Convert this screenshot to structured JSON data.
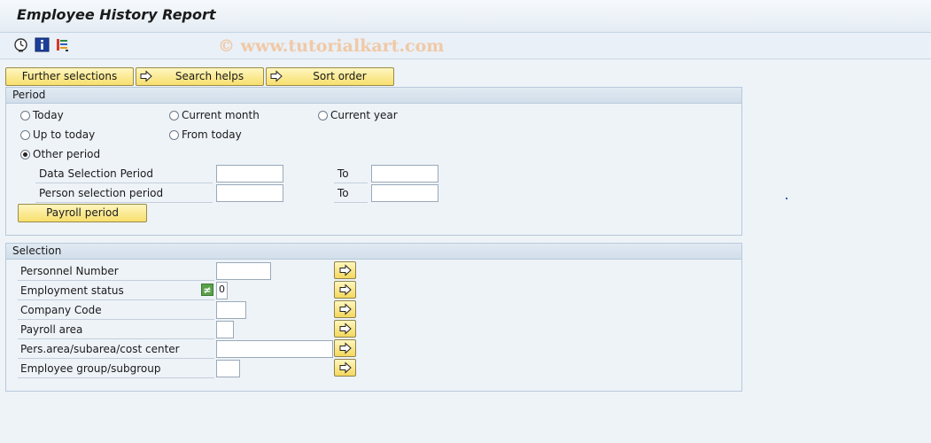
{
  "window": {
    "title": "Employee History Report"
  },
  "toolbar": {
    "icons": [
      "execute-icon",
      "info-icon",
      "variants-icon"
    ],
    "watermark": "© www.tutorialkart.com"
  },
  "buttons": {
    "further_selections": "Further selections",
    "search_helps": "Search helps",
    "sort_order": "Sort order"
  },
  "period": {
    "header": "Period",
    "options": {
      "today": "Today",
      "current_month": "Current month",
      "current_year": "Current year",
      "up_to_today": "Up to today",
      "from_today": "From today",
      "other_period": "Other period"
    },
    "selected": "other_period",
    "data_selection_label": "Data Selection Period",
    "person_selection_label": "Person selection period",
    "to_label": "To",
    "data_from": "",
    "data_to": "",
    "person_from": "",
    "person_to": "",
    "payroll_button": "Payroll period"
  },
  "selection": {
    "header": "Selection",
    "personnel_number": {
      "label": "Personnel Number",
      "value": ""
    },
    "employment_status": {
      "label": "Employment status",
      "operator": "≠",
      "value": "0"
    },
    "company_code": {
      "label": "Company Code",
      "value": ""
    },
    "payroll_area": {
      "label": "Payroll area",
      "value": ""
    },
    "pers_area": {
      "label": "Pers.area/subarea/cost center",
      "value": ""
    },
    "employee_group": {
      "label": "Employee group/subgroup",
      "value": ""
    }
  },
  "colors": {
    "button_yellow": "#f7df6d",
    "group_border": "#b8c9da",
    "background": "#eef3f8",
    "operator_green": "#5aa04a"
  }
}
